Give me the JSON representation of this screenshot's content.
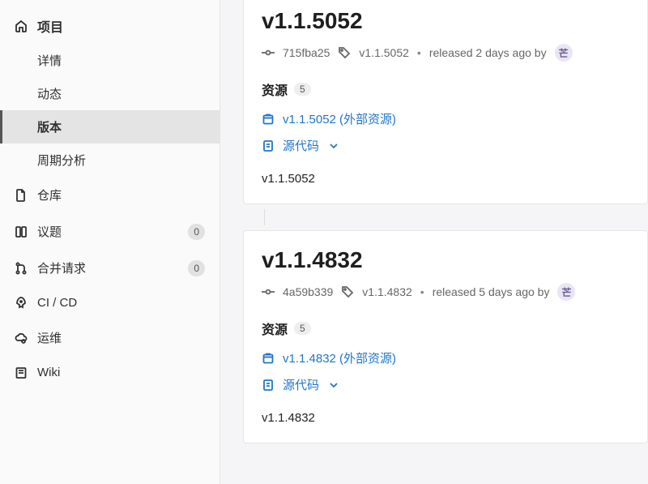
{
  "sidebar": {
    "project_label": "项目",
    "sub_items": [
      {
        "label": "详情",
        "active": false
      },
      {
        "label": "动态",
        "active": false
      },
      {
        "label": "版本",
        "active": true
      },
      {
        "label": "周期分析",
        "active": false
      }
    ],
    "nav": [
      {
        "name": "repository",
        "label": "仓库"
      },
      {
        "name": "issues",
        "label": "议题",
        "count": "0"
      },
      {
        "name": "merge-requests",
        "label": "合并请求",
        "count": "0"
      },
      {
        "name": "cicd",
        "label": "CI / CD"
      },
      {
        "name": "operations",
        "label": "运维"
      },
      {
        "name": "wiki",
        "label": "Wiki"
      }
    ]
  },
  "releases": [
    {
      "title": "v1.1.5052",
      "commit": "715fba25",
      "tag": "v1.1.5052",
      "released_text": "released 2 days ago by",
      "avatar_initial": "芒",
      "assets_label": "资源",
      "assets_count": "5",
      "external_link_label": "v1.1.5052 (外部资源)",
      "source_label": "源代码",
      "body": "v1.1.5052"
    },
    {
      "title": "v1.1.4832",
      "commit": "4a59b339",
      "tag": "v1.1.4832",
      "released_text": "released 5 days ago by",
      "avatar_initial": "芒",
      "assets_label": "资源",
      "assets_count": "5",
      "external_link_label": "v1.1.4832 (外部资源)",
      "source_label": "源代码",
      "body": "v1.1.4832"
    }
  ]
}
